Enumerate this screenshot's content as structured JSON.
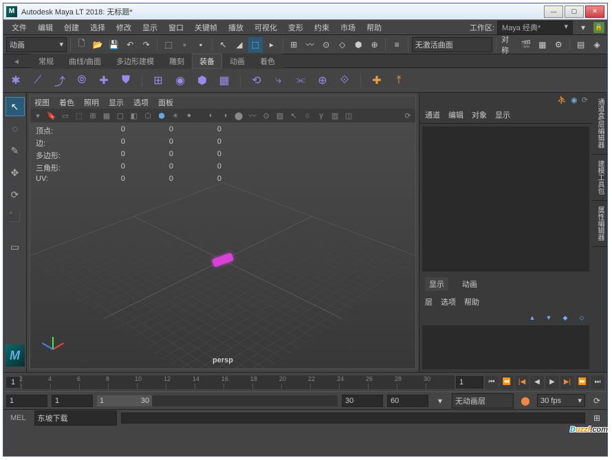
{
  "titlebar": {
    "app_icon": "M",
    "title": "Autodesk Maya LT 2018: 无标题*"
  },
  "winbtns": {
    "min": "—",
    "max": "▢",
    "close": "✕"
  },
  "menu": [
    "文件",
    "编辑",
    "创建",
    "选择",
    "修改",
    "显示",
    "窗口",
    "关键帧",
    "播放",
    "可视化",
    "变形",
    "约束",
    "市场",
    "帮助"
  ],
  "workspace": {
    "label": "工作区:",
    "value": "Maya 经典*"
  },
  "module_selector": "动画",
  "status_field": "无激活曲面",
  "toolbar_right_label": "对称",
  "shelf_tabs": [
    "常规",
    "曲线/曲面",
    "多边形建模",
    "雕刻",
    "装备",
    "动画",
    "着色"
  ],
  "shelf_active": 4,
  "vp_menu": [
    "视图",
    "着色",
    "照明",
    "显示",
    "选项",
    "面板"
  ],
  "stats": {
    "rows": [
      {
        "label": "顶点:",
        "a": "0",
        "b": "0",
        "c": "0"
      },
      {
        "label": "边:",
        "a": "0",
        "b": "0",
        "c": "0"
      },
      {
        "label": "多边形:",
        "a": "0",
        "b": "0",
        "c": "0"
      },
      {
        "label": "三角形:",
        "a": "0",
        "b": "0",
        "c": "0"
      },
      {
        "label": "UV:",
        "a": "0",
        "b": "0",
        "c": "0"
      }
    ]
  },
  "camera": "persp",
  "channel_tabs": [
    "通道",
    "编辑",
    "对象",
    "显示"
  ],
  "layer_tabs": [
    "显示",
    "动画"
  ],
  "layer_menu": [
    "层",
    "选项",
    "帮助"
  ],
  "side_tabs": [
    "通道盒/层编辑器",
    "建模工具包",
    "属性编辑器"
  ],
  "timeline": {
    "start_cur": "1",
    "ticks": [
      "2",
      "4",
      "6",
      "8",
      "10",
      "12",
      "14",
      "16",
      "18",
      "20",
      "22",
      "24",
      "26",
      "28",
      "30"
    ],
    "cur": "1"
  },
  "range": {
    "start": "1",
    "rstart": "1",
    "hstart": "1",
    "hend": "30",
    "rend": "30",
    "end": "60",
    "layer": "无动画层",
    "fps": "30 fps"
  },
  "cmd": {
    "label": "MEL",
    "value": "东坡下载"
  },
  "watermark": {
    "a": "D",
    "b": "uzzf",
    "c": ".com"
  }
}
